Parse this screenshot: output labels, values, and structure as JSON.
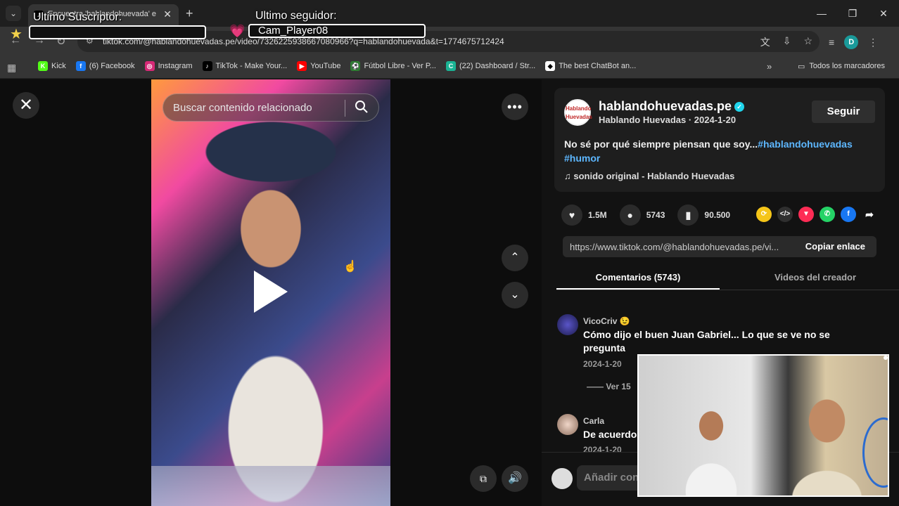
{
  "browser": {
    "tab_title": "Encuentra 'hablandohuevada' e",
    "url": "tiktok.com/@hablandohuevadas.pe/video/7326225938667080966?q=hablandohuevada&t=1774675712424",
    "bookmarks": [
      {
        "label": "Kick",
        "color": "#53fc18",
        "glyph": "K"
      },
      {
        "label": "(6) Facebook",
        "color": "#1877f2",
        "glyph": "f"
      },
      {
        "label": "Instagram",
        "color": "#d62976",
        "glyph": "◎"
      },
      {
        "label": "TikTok - Make Your...",
        "color": "#000000",
        "glyph": "♪"
      },
      {
        "label": "YouTube",
        "color": "#ff0000",
        "glyph": "▶"
      },
      {
        "label": "Fútbol Libre - Ver P...",
        "color": "#2e7d32",
        "glyph": "⚽"
      },
      {
        "label": "(22) Dashboard / Str...",
        "color": "#1ab394",
        "glyph": "C"
      },
      {
        "label": "The best ChatBot an...",
        "color": "#ffffff",
        "glyph": "◆"
      }
    ],
    "all_bookmarks": "Todos los marcadores",
    "profile_initial": "D"
  },
  "overlay": {
    "subscriber_label": "Ultimo Suscriptor:",
    "follower_label": "Ultimo seguidor:",
    "follower_name": "Cam_Player08"
  },
  "video": {
    "search_placeholder": "Buscar contenido relacionado"
  },
  "post": {
    "author": "hablandohuevadas.pe",
    "author_sub": "Hablando Huevadas · 2024-1-20",
    "follow_label": "Seguir",
    "description": "No sé por qué siempre piensan que soy...",
    "hashtag1": "#hablandohuevadas",
    "hashtag2": "#humor",
    "sound": "sonido original - Hablando Huevadas",
    "likes": "1.5M",
    "comments": "5743",
    "saves": "90.500",
    "link": "https://www.tiktok.com/@hablandohuevadas.pe/vi...",
    "copy_label": "Copiar enlace"
  },
  "tabs": {
    "comments": "Comentarios (5743)",
    "creator_videos": "Videos del creador"
  },
  "comments": [
    {
      "user": "VicoCriv 😉",
      "text": "Cómo dijo el buen Juan Gabriel... Lo que se ve no se pregunta",
      "date": "2024-1-20",
      "replies": "Ver 15"
    },
    {
      "user": "Carla",
      "text": "De acuerdo.",
      "date": "2024-1-20"
    }
  ],
  "add_comment_placeholder": "Añadir con"
}
